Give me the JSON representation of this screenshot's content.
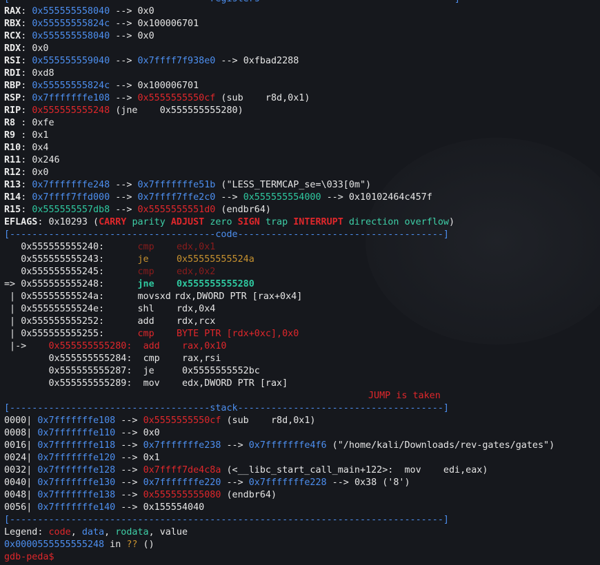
{
  "headers": {
    "registers": "[------------------------------------registers-----------------------------------]",
    "code": "[-------------------------------------code-------------------------------------]",
    "stack": "[------------------------------------stack-------------------------------------]",
    "end": "[------------------------------------------------------------------------------]"
  },
  "registers": {
    "rax": {
      "name": "RAX",
      "v1": "0x555555558040",
      "arrow1": " --> ",
      "v2": "0x0"
    },
    "rbx": {
      "name": "RBX",
      "v1": "0x55555555824c",
      "arrow1": " --> ",
      "v2": "0x100006701"
    },
    "rcx": {
      "name": "RCX",
      "v1": "0x555555558040",
      "arrow1": " --> ",
      "v2": "0x0"
    },
    "rdx": {
      "name": "RDX",
      "v1": "0x0"
    },
    "rsi": {
      "name": "RSI",
      "v1": "0x555555559040",
      "arrow1": " --> ",
      "v2": "0x7ffff7f938e0",
      "arrow2": " --> ",
      "v3": "0xfbad2288"
    },
    "rdi": {
      "name": "RDI",
      "v1": "0xd8"
    },
    "rbp": {
      "name": "RBP",
      "v1": "0x55555555824c",
      "arrow1": " --> ",
      "v2": "0x100006701"
    },
    "rsp": {
      "name": "RSP",
      "v1": "0x7fffffffe108",
      "arrow1": " --> ",
      "v2": "0x5555555550cf",
      "v3": " (sub    r8d,0x1)"
    },
    "rip": {
      "name": "RIP",
      "v1": "0x555555555248",
      "v2": " (jne    0x555555555280)"
    },
    "r8": {
      "name": "R8 ",
      "v1": "0xfe"
    },
    "r9": {
      "name": "R9 ",
      "v1": "0x1"
    },
    "r10": {
      "name": "R10",
      "v1": "0x4"
    },
    "r11": {
      "name": "R11",
      "v1": "0x246"
    },
    "r12": {
      "name": "R12",
      "v1": "0x0"
    },
    "r13": {
      "name": "R13",
      "v1": "0x7fffffffe248",
      "arrow1": " --> ",
      "v2": "0x7fffffffe51b",
      "v3": " (\"LESS_TERMCAP_se=\\033[0m\")"
    },
    "r14": {
      "name": "R14",
      "v1": "0x7ffff7ffd000",
      "arrow1": " --> ",
      "v2": "0x7ffff7ffe2c0",
      "arrow2": " --> ",
      "v3": "0x555555554000",
      "arrow3": " --> ",
      "v4": "0x10102464c457f"
    },
    "r15": {
      "name": "R15",
      "v1": "0x555555557db8",
      "arrow1": " --> ",
      "v2": "0x5555555551d0",
      "v3": " (endbr64)"
    }
  },
  "eflags": {
    "label": "EFLAGS",
    "value": "0x10293",
    "open": " (",
    "flags": [
      "CARRY",
      "parity",
      "ADJUST",
      "zero",
      "SIGN",
      "trap",
      "INTERRUPT",
      "direction",
      "overflow"
    ],
    "close": ")"
  },
  "code": [
    {
      "prefix": "   ",
      "addr": "0x555555555240:",
      "gap": "      ",
      "mn": "cmp",
      "op": "edx,0x1"
    },
    {
      "prefix": "   ",
      "addr": "0x555555555243:",
      "gap": "      ",
      "mn": "je ",
      "op": "0x55555555524a"
    },
    {
      "prefix": "   ",
      "addr": "0x555555555245:",
      "gap": "      ",
      "mn": "cmp",
      "op": "edx,0x2"
    },
    {
      "prefix": "=> ",
      "addr": "0x555555555248:",
      "gap": "      ",
      "mn": "jne",
      "op": "0x555555555280"
    },
    {
      "prefix": " | ",
      "addr": "0x55555555524a:",
      "gap": "      ",
      "mn": "movsxd",
      "op": "rdx,DWORD PTR [rax+0x4]"
    },
    {
      "prefix": " | ",
      "addr": "0x55555555524e:",
      "gap": "      ",
      "mn": "shl",
      "op": "rdx,0x4"
    },
    {
      "prefix": " | ",
      "addr": "0x555555555252:",
      "gap": "      ",
      "mn": "add",
      "op": "rdx,rcx"
    },
    {
      "prefix": " | ",
      "addr": "0x555555555255:",
      "gap": "      ",
      "mn": "cmp",
      "op": "BYTE PTR [rdx+0xc],0x0"
    },
    {
      "prefix": " |->    ",
      "addr": "0x555555555280:",
      "gap": "  ",
      "mn": "add",
      "op": "rax,0x10"
    },
    {
      "prefix": "        ",
      "addr": "0x555555555284:",
      "gap": "  ",
      "mn": "cmp",
      "op": "rax,rsi"
    },
    {
      "prefix": "        ",
      "addr": "0x555555555287:",
      "gap": "  ",
      "mn": "je ",
      "op": "0x5555555552bc"
    },
    {
      "prefix": "        ",
      "addr": "0x555555555289:",
      "gap": "  ",
      "mn": "mov",
      "op": "edx,DWORD PTR [rax]"
    }
  ],
  "jump_msg": "JUMP is taken",
  "stack": [
    {
      "off": "0000",
      "a": "0x7fffffffe108",
      "b": "0x5555555550cf",
      "c": " (sub    r8d,0x1)"
    },
    {
      "off": "0008",
      "a": "0x7fffffffe110",
      "b": "0x0"
    },
    {
      "off": "0016",
      "a": "0x7fffffffe118",
      "b": "0x7fffffffe238",
      "c": "0x7fffffffe4f6",
      "d": " (\"/home/kali/Downloads/rev-gates/gates\")"
    },
    {
      "off": "0024",
      "a": "0x7fffffffe120",
      "b": "0x1"
    },
    {
      "off": "0032",
      "a": "0x7fffffffe128",
      "b": "0x7ffff7de4c8a",
      "c": " (<__libc_start_call_main+122>:  mov    edi,eax)"
    },
    {
      "off": "0040",
      "a": "0x7fffffffe130",
      "b": "0x7fffffffe220",
      "c": "0x7fffffffe228",
      "d": "0x38 ('8')"
    },
    {
      "off": "0048",
      "a": "0x7fffffffe138",
      "b": "0x555555555080",
      "c": " (endbr64)"
    },
    {
      "off": "0056",
      "a": "0x7fffffffe140",
      "b": "0x155554040"
    }
  ],
  "arrow": " --> ",
  "legend": {
    "label": "Legend: ",
    "code": "code",
    "data": "data",
    "rodata": "rodata",
    "value": "value",
    "sep": ", "
  },
  "location": {
    "addr": "0x0000555555555248",
    "in": " in ",
    "q": "??",
    "paren": " ()"
  },
  "prompt": "gdb-peda$"
}
